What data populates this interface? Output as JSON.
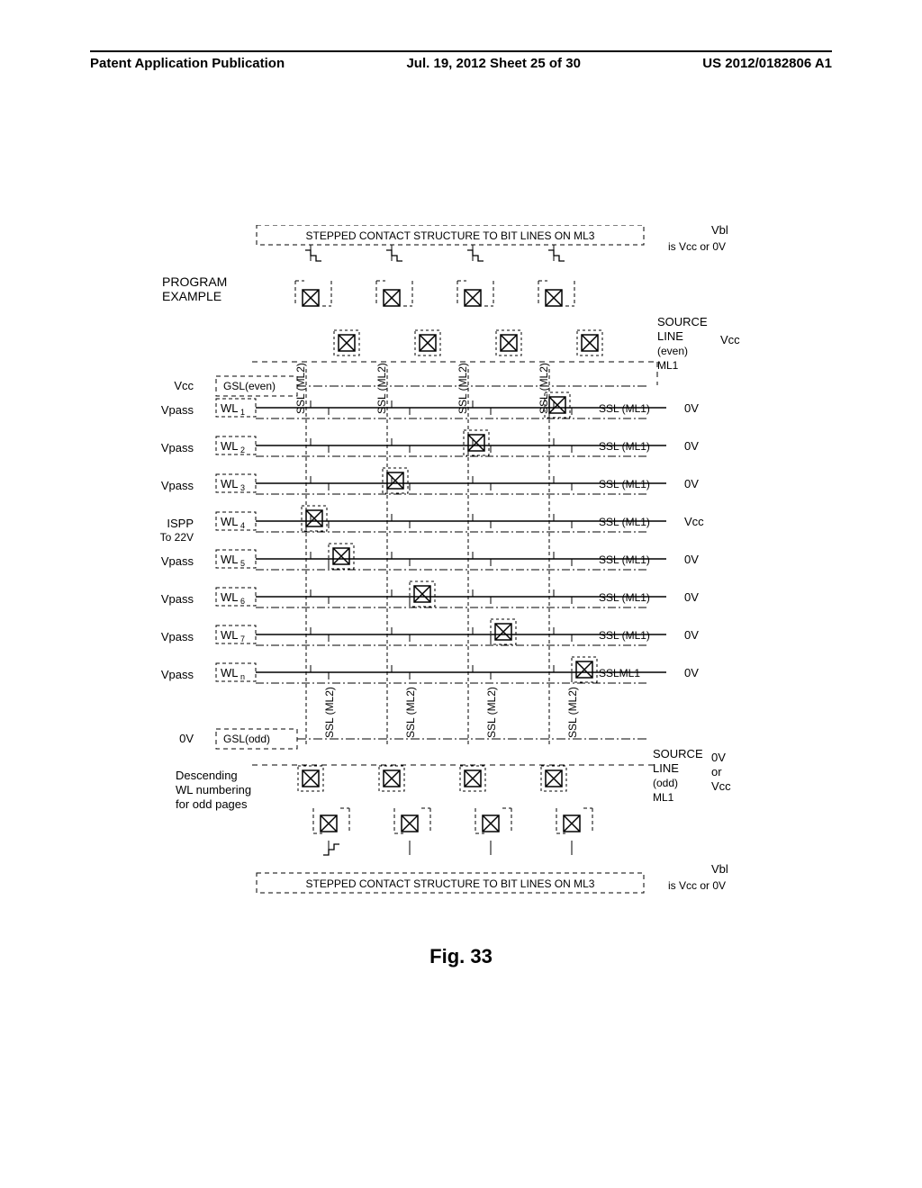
{
  "header": {
    "left": "Patent Application Publication",
    "center": "Jul. 19, 2012  Sheet 25 of 30",
    "right": "US 2012/0182806 A1"
  },
  "figure_label": "Fig. 33",
  "top_note": {
    "line1": "Vbl",
    "line2": "is Vcc or 0V"
  },
  "bottom_note": {
    "line1": "Vbl",
    "line2": "is Vcc or 0V"
  },
  "program_title": {
    "l1": "PROGRAM",
    "l2": "EXAMPLE"
  },
  "descending_note": {
    "l1": "Descending",
    "l2": "WL numbering",
    "l3": "for odd pages"
  },
  "stepped_top": "STEPPED CONTACT STRUCTURE TO BIT LINES ON ML3",
  "stepped_bottom": "STEPPED CONTACT STRUCTURE TO BIT LINES ON ML3",
  "gsl_even": {
    "v": "Vcc",
    "label": "GSL(even)"
  },
  "gsl_odd": {
    "v": "0V",
    "label": "GSL(odd)"
  },
  "source_even": {
    "title": "SOURCE",
    "title2": "LINE",
    "sub1": "(even)",
    "sub2": "ML1",
    "v": "Vcc"
  },
  "source_odd": {
    "title": "SOURCE",
    "title2": "LINE",
    "sub1": "(odd)",
    "sub2": "ML1",
    "v": "0V",
    "v2": "or",
    "v3": "Vcc"
  },
  "ssl_vert": "SSL (ML2)",
  "rows": [
    {
      "vleft": "Vpass",
      "wl": "WL",
      "wln": "1",
      "sslr": "SSL (ML1)",
      "vr": "0V"
    },
    {
      "vleft": "Vpass",
      "wl": "WL",
      "wln": "2",
      "sslr": "SSL (ML1)",
      "vr": "0V"
    },
    {
      "vleft": "Vpass",
      "wl": "WL",
      "wln": "3",
      "sslr": "SSL (ML1)",
      "vr": "0V"
    },
    {
      "vleft": "ISPP",
      "vleft2": "To 22V",
      "wl": "WL",
      "wln": "4",
      "sslr": "SSL (ML1)",
      "vr": "Vcc"
    },
    {
      "vleft": "Vpass",
      "wl": "WL",
      "wln": "5",
      "sslr": "SSL (ML1)",
      "vr": "0V"
    },
    {
      "vleft": "Vpass",
      "wl": "WL",
      "wln": "6",
      "sslr": "SSL (ML1)",
      "vr": "0V"
    },
    {
      "vleft": "Vpass",
      "wl": "WL",
      "wln": "7",
      "sslr": "SSL (ML1)",
      "vr": "0V"
    },
    {
      "vleft": "Vpass",
      "wl": "WL",
      "wln": "n",
      "sslr": "SSLML1",
      "vr": "0V"
    }
  ]
}
